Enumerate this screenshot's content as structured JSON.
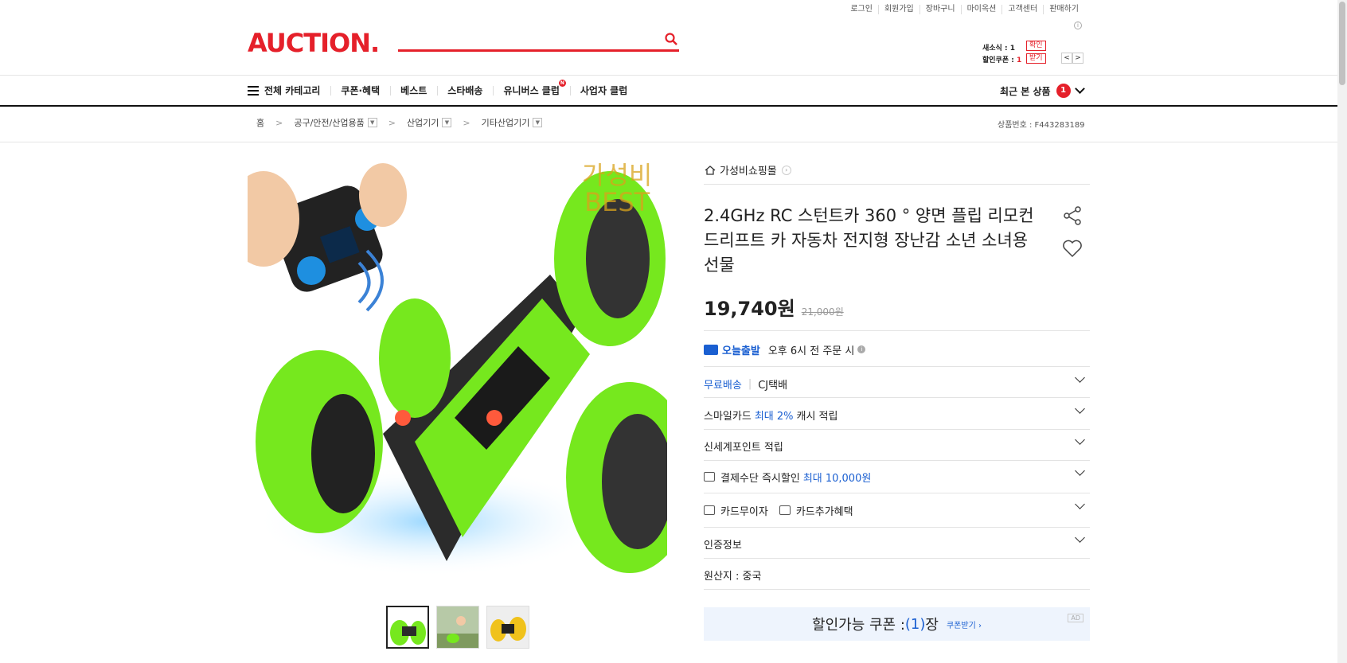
{
  "util_links": [
    "로그인",
    "회원가입",
    "장바구니",
    "마이옥션",
    "고객센터",
    "판매하기"
  ],
  "logo": "AUCTION.",
  "mini": {
    "news_label": "새소식 : 1",
    "news_btn": "확인",
    "coupon_label": "할인쿠폰 : ",
    "coupon_count": "1",
    "coupon_btn": "받기"
  },
  "gnb": {
    "items": [
      "전체 카테고리",
      "쿠폰·혜택",
      "베스트",
      "스타배송",
      "유니버스 클럽",
      "사업자 클럽"
    ],
    "newdot": "N",
    "recent_label": "최근 본 상품",
    "recent_count": "1"
  },
  "breadcrumb": {
    "home": "홈",
    "cat1": "공구/안전/산업용품",
    "cat2": "산업기기",
    "cat3": "기타산업기기"
  },
  "product_no": "상품번호 : F443283189",
  "image_overlay": {
    "line1": "가성비",
    "line2": "BEST"
  },
  "shop_name": "가성비쇼핑몰",
  "title": "2.4GHz RC 스턴트카 360 ° 양면 플립 리모컨 드리프트 카 자동차 전지형 장난감 소년 소녀용 선물",
  "price": {
    "now": "19,740원",
    "original": "21,000원"
  },
  "delivery": {
    "label": "오늘출발",
    "desc": "오후 6시 전 주문 시"
  },
  "rows": {
    "shipping_free": "무료배송",
    "shipping_carrier": "CJ택배",
    "smile_prefix": "스마일카드 ",
    "smile_highlight": "최대 2%",
    "smile_suffix": " 캐시 적립",
    "shinsegae": "신세계포인트 적립",
    "payment_prefix": "결제수단 즉시할인 ",
    "payment_highlight": "최대 10,000원",
    "card_nointerest": "카드무이자",
    "card_extra": "카드추가혜택",
    "cert": "인증정보",
    "origin": "원산지 : 중국"
  },
  "coupon": {
    "prefix": "할인가능 쿠폰 : ",
    "count": "(1)",
    "suffix": "장",
    "get": "쿠폰받기 ›",
    "ad": "AD"
  },
  "colors": {
    "brand": "#e5202a",
    "accent_blue": "#1a5fd1",
    "car_green": "#76e81e"
  }
}
